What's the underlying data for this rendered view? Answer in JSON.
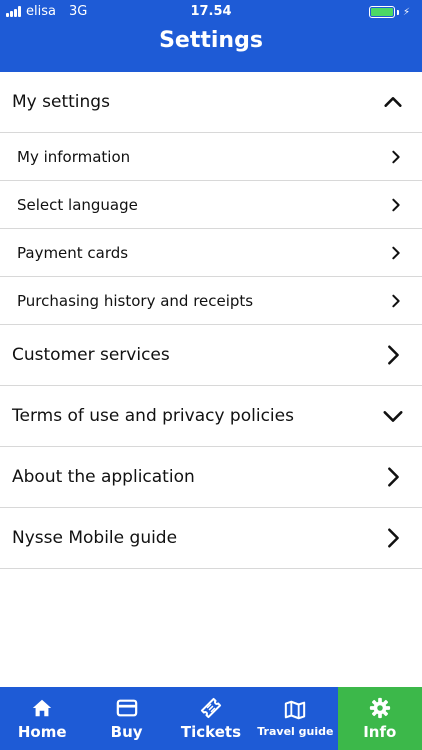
{
  "status_bar": {
    "carrier": "elisa",
    "network": "3G",
    "time": "17.54"
  },
  "header": {
    "title": "Settings"
  },
  "settings": {
    "my_settings": {
      "label": "My settings",
      "items": [
        {
          "label": "My information"
        },
        {
          "label": "Select language"
        },
        {
          "label": "Payment cards"
        },
        {
          "label": "Purchasing history and receipts"
        }
      ]
    },
    "customer_services": {
      "label": "Customer services"
    },
    "terms": {
      "label": "Terms of use and privacy policies"
    },
    "about": {
      "label": "About the application"
    },
    "guide": {
      "label": "Nysse Mobile guide"
    }
  },
  "tabbar": {
    "items": [
      {
        "label": "Home",
        "icon": "home-icon"
      },
      {
        "label": "Buy",
        "icon": "card-icon"
      },
      {
        "label": "Tickets",
        "icon": "ticket-icon"
      },
      {
        "label": "Travel guide",
        "icon": "map-icon"
      },
      {
        "label": "Info",
        "icon": "gear-icon"
      }
    ],
    "active": "Info"
  },
  "colors": {
    "brand_blue": "#1e5bd6",
    "active_green": "#3cb84a",
    "battery_green": "#4cd964"
  }
}
